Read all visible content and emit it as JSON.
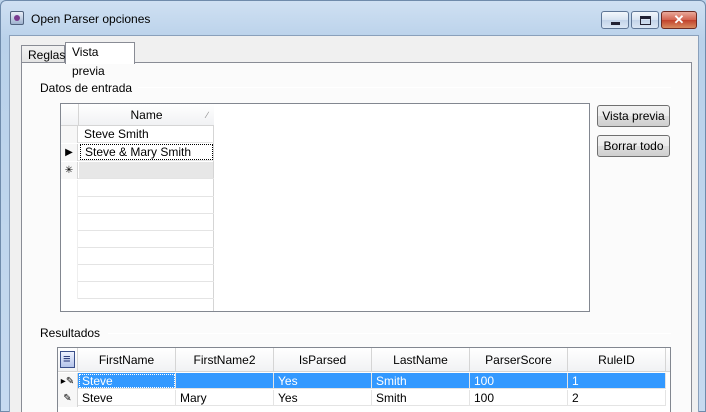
{
  "window": {
    "title": "Open Parser opciones"
  },
  "tabs": [
    {
      "label": "Reglas",
      "active": false
    },
    {
      "label": "Vista previa",
      "active": true
    }
  ],
  "input_section": {
    "group_label": "Datos de entrada",
    "column_header": "Name",
    "rows": [
      {
        "indicator": "",
        "value": "Steve Smith"
      },
      {
        "indicator": "▶",
        "value": "Steve & Mary Smith"
      },
      {
        "indicator": "✳",
        "value": ""
      }
    ]
  },
  "buttons": {
    "preview": "Vista previa",
    "clear_all": "Borrar todo"
  },
  "results_section": {
    "group_label": "Resultados",
    "columns": [
      "FirstName",
      "FirstName2",
      "IsParsed",
      "LastName",
      "ParserScore",
      "RuleID"
    ],
    "rows": [
      {
        "indicator": "▸✎",
        "selected": true,
        "cells": [
          "Steve",
          "",
          "Yes",
          "Smith",
          "100",
          "1"
        ]
      },
      {
        "indicator": "✎",
        "selected": false,
        "cells": [
          "Steve",
          "Mary",
          "Yes",
          "Smith",
          "100",
          "2"
        ]
      }
    ]
  }
}
